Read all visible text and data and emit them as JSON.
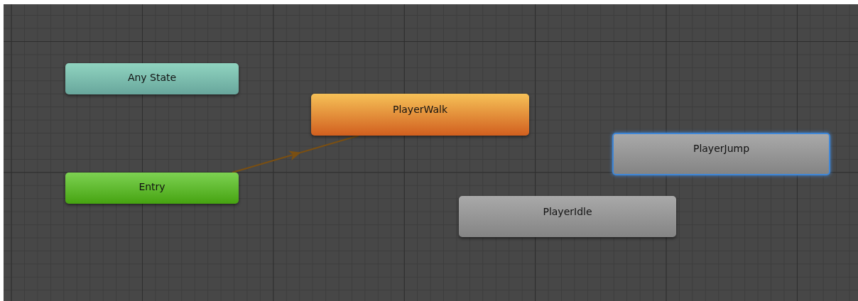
{
  "states": [
    {
      "name": "Any State",
      "kind": "any",
      "selected": false
    },
    {
      "name": "PlayerWalk",
      "kind": "default",
      "selected": false
    },
    {
      "name": "PlayerJump",
      "kind": "normal",
      "selected": true
    },
    {
      "name": "PlayerIdle",
      "kind": "normal",
      "selected": false
    },
    {
      "name": "Entry",
      "kind": "entry",
      "selected": false
    }
  ]
}
